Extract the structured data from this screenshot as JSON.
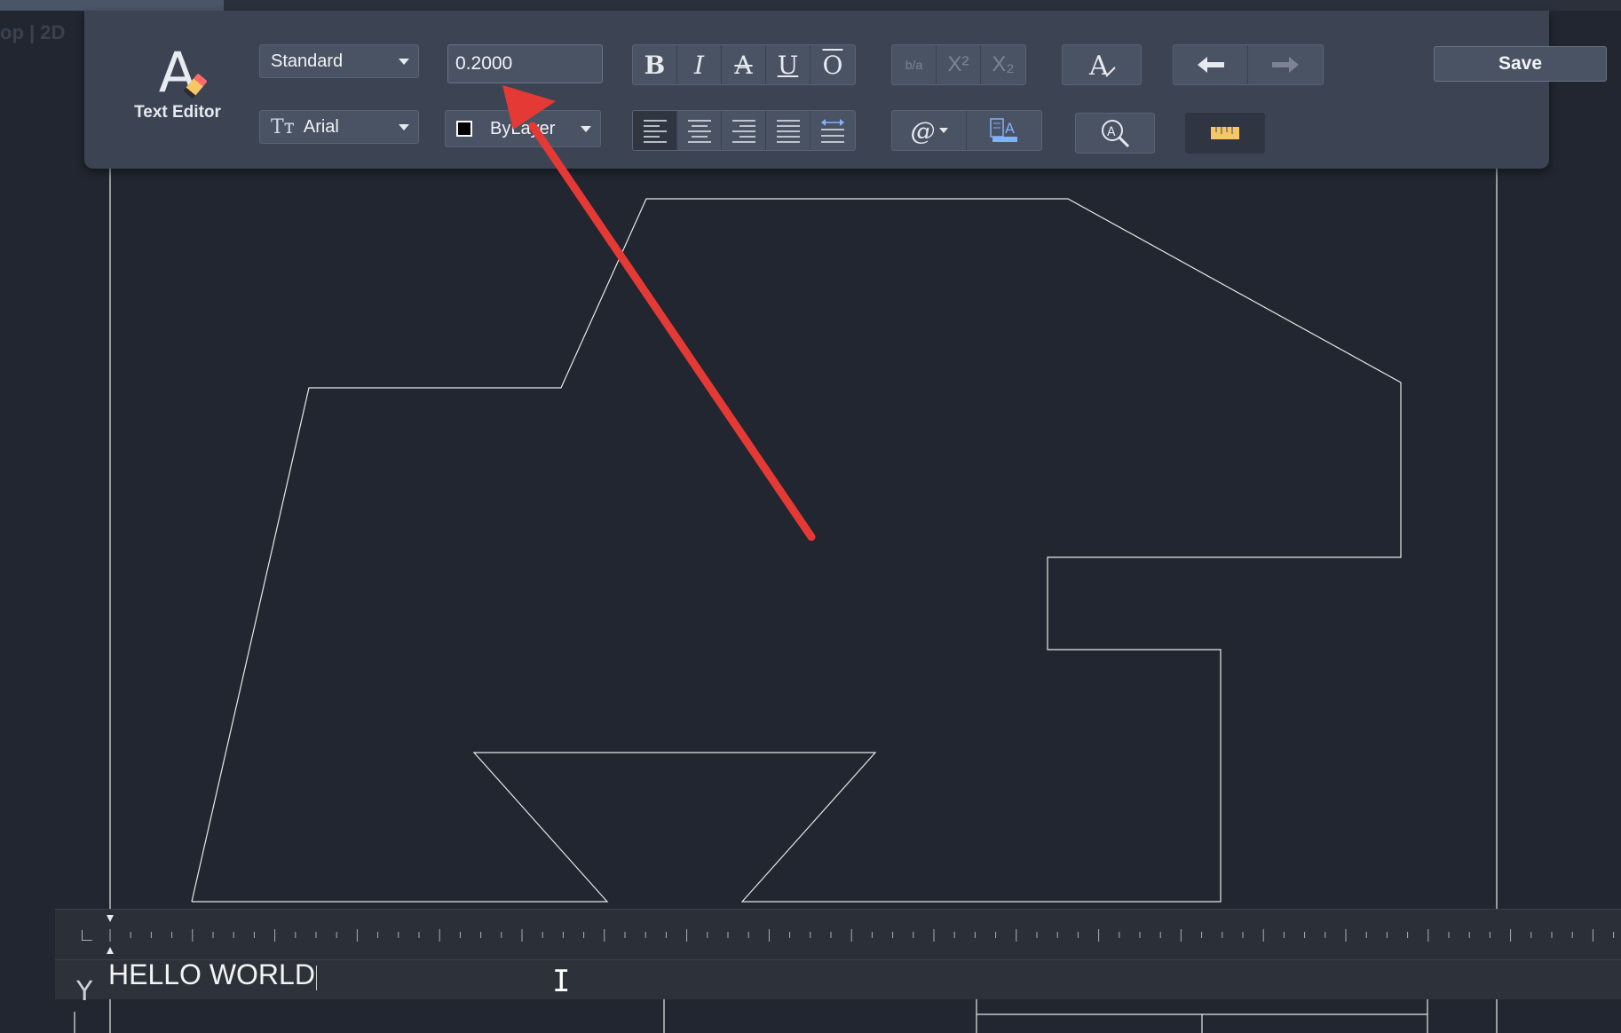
{
  "view_label": "op | 2D",
  "editor": {
    "title": "Text Editor",
    "style_value": "Standard",
    "height_value": "0.2000",
    "font_value": "Arial",
    "color_value": "ByLayer",
    "save_label": "Save"
  },
  "format_buttons": [
    "B",
    "I",
    "A",
    "U",
    "O"
  ],
  "script_buttons": [
    "b/a",
    "X²",
    "X₂"
  ],
  "text_content": "HELLO WORLD",
  "icons": {
    "logo": "text-editor-logo-icon",
    "font_prefix": "tt-font-icon",
    "clear_format": "clear-format-icon",
    "undo": "undo-icon",
    "redo": "redo-icon",
    "align": [
      "align-left-icon",
      "align-center-icon",
      "align-right-icon",
      "align-justify-icon",
      "distribute-icon"
    ],
    "symbol": "at-symbol-icon",
    "columns": "columns-icon",
    "find": "find-replace-icon",
    "ruler": "ruler-icon"
  },
  "colors": {
    "ribbon": "#3c4454",
    "canvas": "#212630",
    "annotation_arrow": "#e53935",
    "ruler_accent": "#f6c667"
  }
}
